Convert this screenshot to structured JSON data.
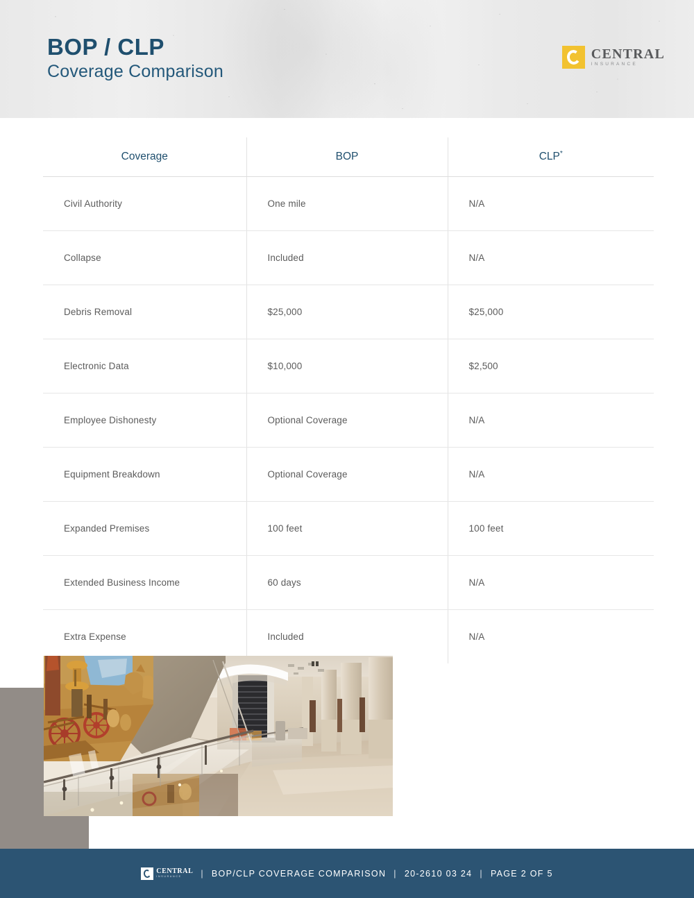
{
  "header": {
    "title_main": "BOP / CLP",
    "title_sub": "Coverage Comparison",
    "logo": {
      "word": "CENTRAL",
      "tagline": "INSURANCE",
      "mark_color": "#f2c230"
    }
  },
  "table": {
    "columns": [
      "Coverage",
      "BOP",
      "CLP"
    ],
    "clp_superscript": "*",
    "rows": [
      {
        "coverage": "Civil Authority",
        "bop": "One mile",
        "clp": "N/A"
      },
      {
        "coverage": "Collapse",
        "bop": "Included",
        "clp": "N/A"
      },
      {
        "coverage": "Debris Removal",
        "bop": "$25,000",
        "clp": "$25,000"
      },
      {
        "coverage": "Electronic Data",
        "bop": "$10,000",
        "clp": "$2,500"
      },
      {
        "coverage": "Employee Dishonesty",
        "bop": "Optional Coverage",
        "clp": "N/A"
      },
      {
        "coverage": "Equipment Breakdown",
        "bop": "Optional Coverage",
        "clp": "N/A"
      },
      {
        "coverage": "Expanded Premises",
        "bop": "100 feet",
        "clp": "100 feet"
      },
      {
        "coverage": "Extended Business Income",
        "bop": "60 days",
        "clp": "N/A"
      },
      {
        "coverage": "Extra Expense",
        "bop": "Included",
        "clp": "N/A"
      }
    ]
  },
  "photo": {
    "alt": "Museum atrium interior with large mural, glass railings, escalator and stone columns"
  },
  "footer": {
    "logo_word": "CENTRAL",
    "logo_tagline": "INSURANCE",
    "sep1": "|",
    "document_title": "BOP/CLP COVERAGE COMPARISON",
    "sep2": "|",
    "document_code": "20-2610 03 24",
    "sep3": "|",
    "page_label": "PAGE 2 OF 5",
    "bar_color": "#2c5473"
  },
  "colors": {
    "heading_navy": "#1f4f6e",
    "body_gray": "#5b5b5b",
    "taupe_block": "#928c87",
    "brand_gold": "#f2c230"
  }
}
